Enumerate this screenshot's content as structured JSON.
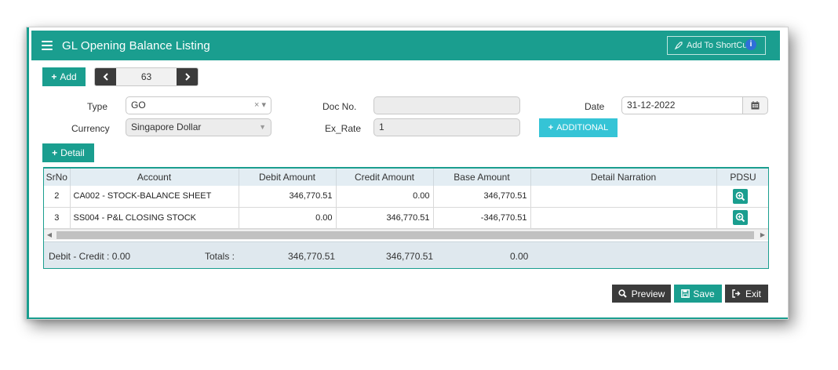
{
  "header": {
    "title": "GL Opening Balance Listing",
    "shortcut_label": "Add To ShortCut",
    "info_badge": "i"
  },
  "toolbar": {
    "add_label": "Add",
    "record_number": "63"
  },
  "form": {
    "type_label": "Type",
    "type_value": "GO",
    "currency_label": "Currency",
    "currency_value": "Singapore Dollar",
    "doc_no_label": "Doc No.",
    "doc_no_value": "",
    "ex_rate_label": "Ex_Rate",
    "ex_rate_value": "1",
    "date_label": "Date",
    "date_value": "31-12-2022",
    "additional_label": "ADDITIONAL",
    "detail_label": "Detail"
  },
  "grid": {
    "columns": [
      "SrNo",
      "Account",
      "Debit Amount",
      "Credit Amount",
      "Base Amount",
      "Detail Narration",
      "PDSU"
    ],
    "rows": [
      {
        "srno": "2",
        "account": "CA002 - STOCK-BALANCE SHEET",
        "debit": "346,770.51",
        "credit": "0.00",
        "base": "346,770.51",
        "narration": ""
      },
      {
        "srno": "3",
        "account": "SS004 - P&L CLOSING STOCK",
        "debit": "0.00",
        "credit": "346,770.51",
        "base": "-346,770.51",
        "narration": ""
      }
    ],
    "footer": {
      "diff_label": "Debit - Credit : 0.00",
      "totals_label": "Totals :",
      "debit_total": "346,770.51",
      "credit_total": "346,770.51",
      "base_total": "0.00"
    }
  },
  "actions": {
    "preview_label": "Preview",
    "save_label": "Save",
    "exit_label": "Exit"
  },
  "colors": {
    "primary": "#1a9e8f",
    "accent_cyan": "#35c4d6",
    "dark_button": "#3b3b3b",
    "grid_header": "#e3edf3"
  }
}
